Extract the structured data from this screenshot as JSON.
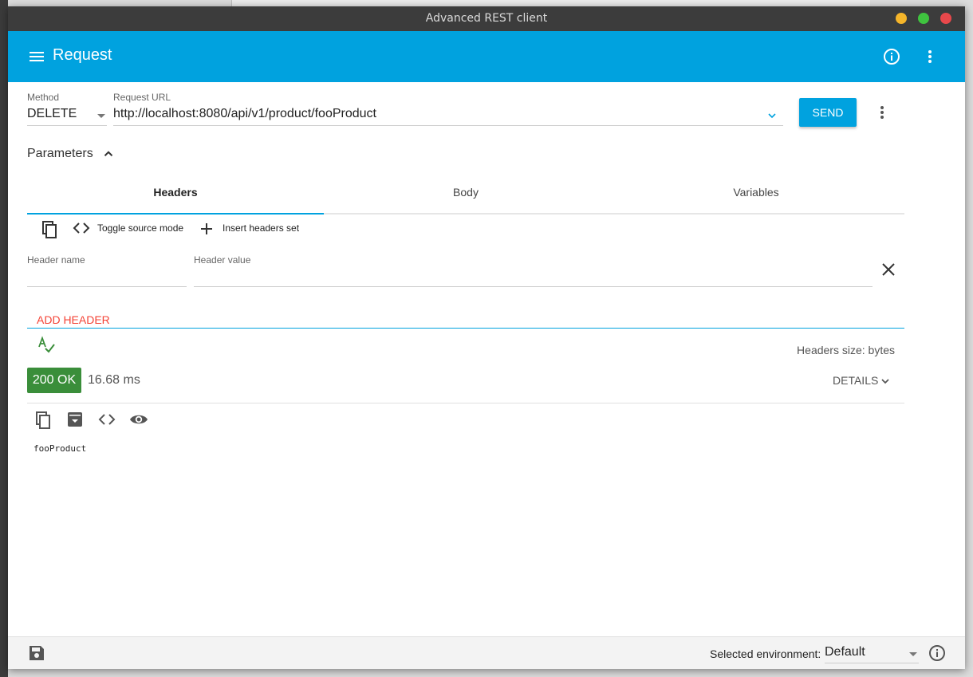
{
  "window": {
    "title": "Advanced REST client"
  },
  "appbar": {
    "title": "Request"
  },
  "request": {
    "method_label": "Method",
    "method_value": "DELETE",
    "url_label": "Request URL",
    "url_value": "http://localhost:8080/api/v1/product/fooProduct",
    "send_label": "SEND"
  },
  "parameters": {
    "label": "Parameters",
    "tabs": [
      {
        "label": "Headers",
        "active": true
      },
      {
        "label": "Body",
        "active": false
      },
      {
        "label": "Variables",
        "active": false
      }
    ]
  },
  "headers_toolbar": {
    "toggle_label": "Toggle source mode",
    "insert_label": "Insert headers set"
  },
  "header_form": {
    "name_label": "Header name",
    "value_label": "Header value",
    "add_label": "ADD HEADER",
    "size_text": "Headers size: bytes"
  },
  "response": {
    "status": "200 OK",
    "status_color": "#3a8e3a",
    "time": "16.68 ms",
    "details_label": "DETAILS",
    "body": "fooProduct"
  },
  "footer": {
    "env_label": "Selected environment:",
    "env_value": "Default"
  },
  "colors": {
    "accent": "#00a2df",
    "add_header": "#f44336"
  },
  "icons": [
    "menu-icon",
    "info-icon",
    "more-vert-icon",
    "copy-icon",
    "code-icon",
    "plus-icon",
    "close-icon",
    "spellcheck-icon",
    "archive-icon",
    "eye-icon",
    "save-icon"
  ]
}
